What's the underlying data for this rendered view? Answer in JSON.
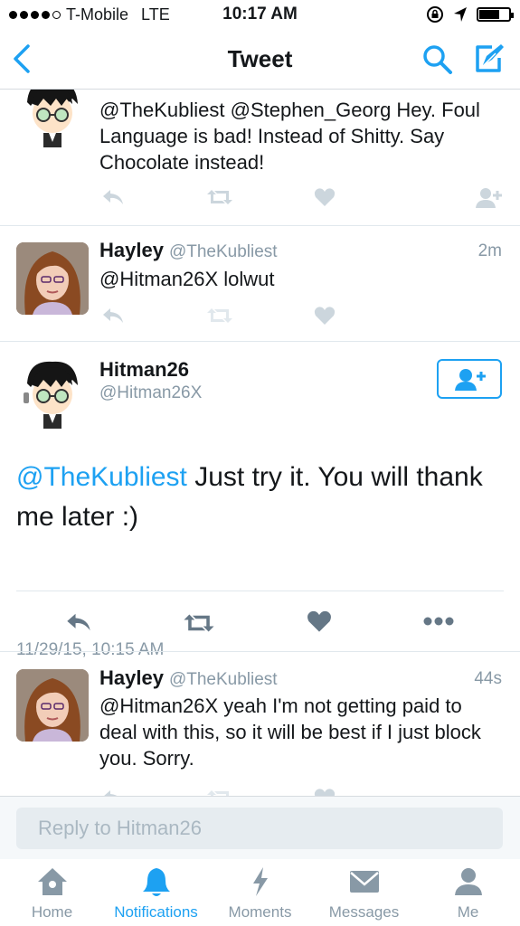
{
  "status_bar": {
    "carrier": "T-Mobile",
    "network": "LTE",
    "time": "10:17 AM"
  },
  "nav": {
    "title": "Tweet"
  },
  "tweets": [
    {
      "name": "",
      "handle": "",
      "text": "@TheKubliest @Stephen_Georg Hey. Foul Language is bad! Instead of Shitty. Say Chocolate instead!"
    },
    {
      "name": "Hayley",
      "handle": "@TheKubliest",
      "time": "2m",
      "text": "@Hitman26X lolwut"
    },
    {
      "name": "Hitman26",
      "handle": "@Hitman26X",
      "mention": "@TheKubliest",
      "text": " Just try it. You will thank me later :)",
      "timestamp": "11/29/15, 10:15 AM"
    },
    {
      "name": "Hayley",
      "handle": "@TheKubliest",
      "time": "44s",
      "text": "@Hitman26X yeah I'm not getting paid to deal with this, so it will be best if I just block you. Sorry."
    }
  ],
  "reply": {
    "placeholder": "Reply to Hitman26"
  },
  "tabs": [
    {
      "label": "Home",
      "icon": "home-icon"
    },
    {
      "label": "Notifications",
      "icon": "bell-icon",
      "active": true
    },
    {
      "label": "Moments",
      "icon": "lightning-icon"
    },
    {
      "label": "Messages",
      "icon": "envelope-icon"
    },
    {
      "label": "Me",
      "icon": "person-icon"
    }
  ],
  "colors": {
    "accent": "#1da1f2",
    "muted": "#8899a6",
    "text": "#14171a"
  }
}
